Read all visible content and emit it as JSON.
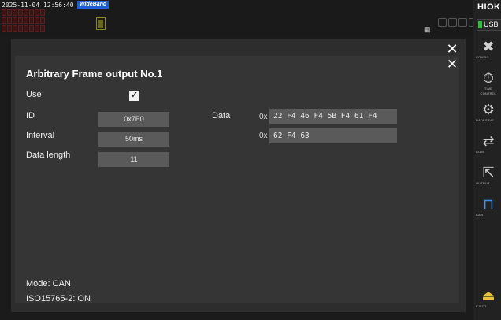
{
  "status_bar": {
    "datetime": "2025-11-04 12:56:40",
    "mode_badge": "WideBand"
  },
  "sidebar": {
    "brand": "HIOKI",
    "usb_label": "USB",
    "buttons": [
      {
        "name": "config",
        "icon": "tools-icon",
        "label": "CONFIG"
      },
      {
        "name": "time-control",
        "icon": "timer-icon",
        "label": "TIME CONTROL"
      },
      {
        "name": "data-save",
        "icon": "data-save-icon",
        "label": "DATA SAVE"
      },
      {
        "name": "com",
        "icon": "com-icon",
        "label": "COM"
      },
      {
        "name": "output",
        "icon": "output-icon",
        "label": "OUTPUT"
      },
      {
        "name": "can",
        "icon": "can-wave-icon",
        "label": "CAN"
      },
      {
        "name": "eject",
        "icon": "eject-icon",
        "label": "EJECT"
      }
    ]
  },
  "dialog": {
    "title": "Arbitrary Frame output No.1",
    "use_label": "Use",
    "use_checked": true,
    "id_label": "ID",
    "id_value": "0x7E0",
    "interval_label": "Interval",
    "interval_value": "50ms",
    "data_length_label": "Data length",
    "data_length_value": "11",
    "data_label": "Data",
    "hex_prefix": "0x",
    "data_rows": [
      "22 F4 46 F4 5B F4 61 F4",
      "62 F4 63"
    ],
    "mode_text": "Mode: CAN",
    "iso_text": "ISO15765-2: ON"
  },
  "colors": {
    "background": "#1b1b1b",
    "panel": "#2d2d2d",
    "dialog": "#353535",
    "field": "#5a5a5a",
    "badge": "#1e5fd6",
    "accent_blue": "#4a8fe0",
    "usb_led": "#2fbf3a"
  }
}
